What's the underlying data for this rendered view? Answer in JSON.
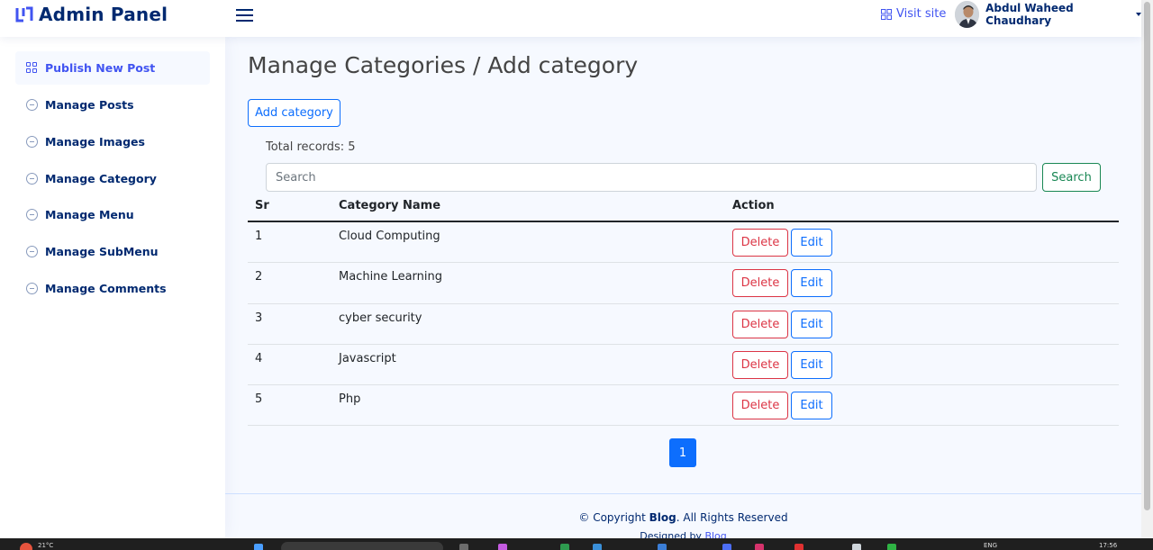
{
  "header": {
    "logo_text": "Admin Panel",
    "visit_site": "Visit site",
    "user_name": "Abdul Waheed Chaudhary"
  },
  "sidebar": {
    "items": [
      {
        "label": "Publish New Post",
        "icon": "grid-icon",
        "active": true
      },
      {
        "label": "Manage Posts",
        "icon": "dash-circle-icon"
      },
      {
        "label": "Manage Images",
        "icon": "dash-circle-icon"
      },
      {
        "label": "Manage Category",
        "icon": "dash-circle-icon"
      },
      {
        "label": "Manage Menu",
        "icon": "dash-circle-icon"
      },
      {
        "label": "Manage SubMenu",
        "icon": "dash-circle-icon"
      },
      {
        "label": "Manage Comments",
        "icon": "dash-circle-icon"
      }
    ]
  },
  "main": {
    "title": "Manage Categories / Add category",
    "add_button": "Add category",
    "total_records": "Total records: 5",
    "search_placeholder": "Search",
    "search_button": "Search",
    "table": {
      "headers": [
        "Sr",
        "Category Name",
        "Action"
      ],
      "rows": [
        {
          "sr": "1",
          "name": "Cloud Computing"
        },
        {
          "sr": "2",
          "name": "Machine Learning"
        },
        {
          "sr": "3",
          "name": "cyber security"
        },
        {
          "sr": "4",
          "name": "Javascript"
        },
        {
          "sr": "5",
          "name": "Php"
        }
      ],
      "delete_label": "Delete",
      "edit_label": "Edit"
    },
    "pagination": {
      "current_page": "1"
    }
  },
  "footer": {
    "copyright_prefix": "© Copyright ",
    "brand": "Blog",
    "copyright_suffix": ". All Rights Reserved",
    "designed_prefix": "Designed by ",
    "designed_brand": "Blog"
  },
  "taskbar": {
    "temperature": "21°C",
    "language": "ENG",
    "time": "17:56"
  },
  "colors": {
    "primary": "#4154f1",
    "navy": "#012970",
    "danger": "#dc3545",
    "success": "#198754",
    "bootstrap_blue": "#0d6efd"
  }
}
